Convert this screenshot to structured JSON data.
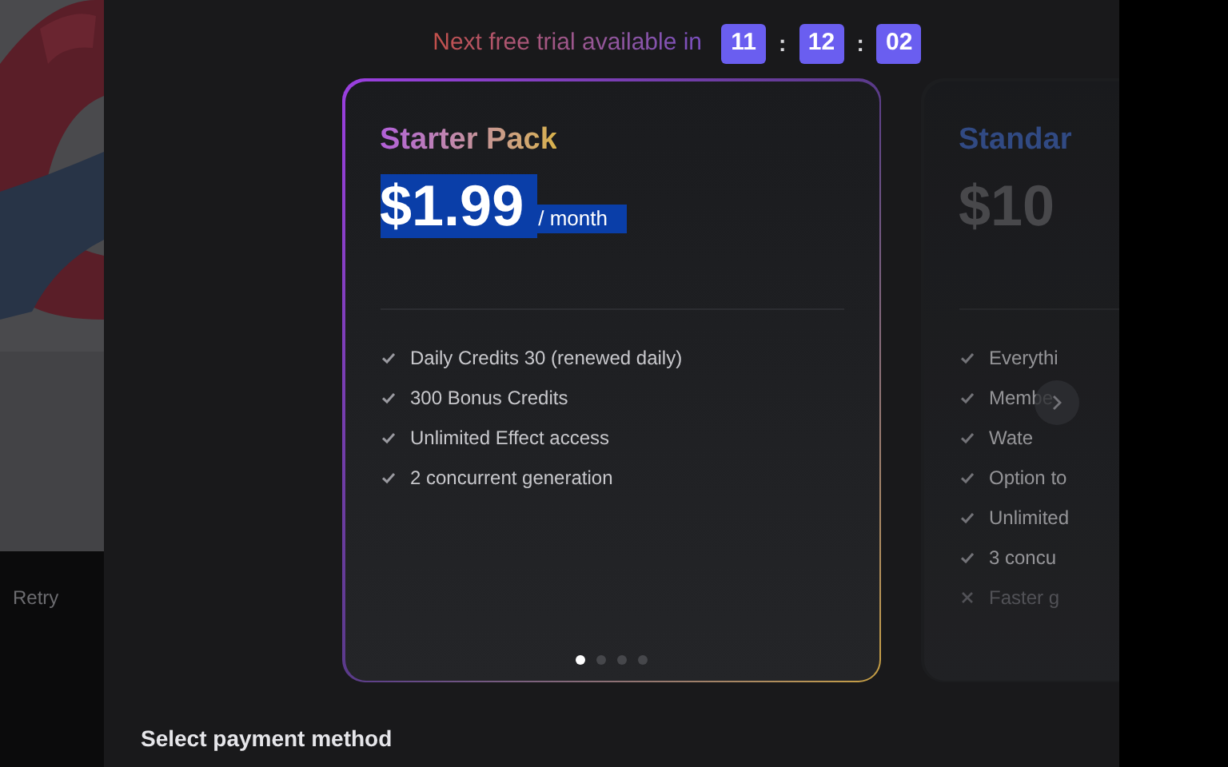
{
  "background": {
    "retry_label": "Retry"
  },
  "trial_timer": {
    "label": "Next free trial available in",
    "separator": ":",
    "parts": [
      "11",
      "12",
      "02"
    ]
  },
  "plans": [
    {
      "title": "Starter Pack",
      "price": "$1.99",
      "period": "/ month",
      "highlighted": true,
      "features": [
        {
          "text": "Daily Credits 30 (renewed daily)",
          "included": true
        },
        {
          "text": "300 Bonus Credits",
          "included": true
        },
        {
          "text": "Unlimited Effect access",
          "included": true
        },
        {
          "text": "2 concurrent generation",
          "included": true
        }
      ]
    },
    {
      "title": "Standar",
      "price": "$10",
      "highlighted": false,
      "features": [
        {
          "text": "Everythi",
          "included": true
        },
        {
          "text": "Membe",
          "included": true
        },
        {
          "text": "Wate",
          "included": true
        },
        {
          "text": "Option to",
          "included": true
        },
        {
          "text": "Unlimited",
          "included": true
        },
        {
          "text": "3 concu",
          "included": true
        },
        {
          "text": "Faster g",
          "included": false
        }
      ]
    }
  ],
  "carousel_dots": [
    {
      "selected": true
    },
    {
      "selected": false
    },
    {
      "selected": false
    },
    {
      "selected": false
    }
  ],
  "payment_heading": "Select payment method"
}
